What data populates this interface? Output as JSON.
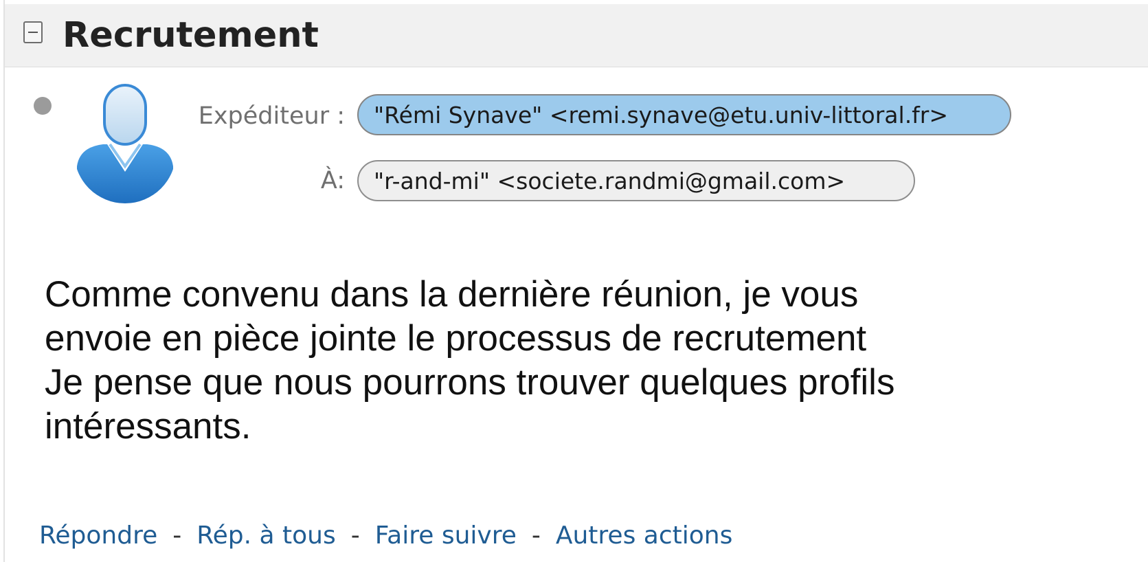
{
  "message": {
    "subject": "Recrutement",
    "from_label": "Expéditeur :",
    "from_value": "\"Rémi Synave\" <remi.synave@etu.univ-littoral.fr>",
    "to_label": "À:",
    "to_value": "\"r-and-mi\" <societe.randmi@gmail.com>",
    "body_lines": [
      "Comme convenu dans la dernière réunion, je vous",
      "envoie en pièce jointe le processus de recrutement",
      "Je pense que nous pourrons trouver quelques profils",
      "intéressants."
    ]
  },
  "actions": {
    "reply": "Répondre",
    "reply_all": "Rép. à tous",
    "forward": "Faire suivre",
    "more": "Autres actions",
    "separator": "-"
  },
  "icons": {
    "collapse": "collapse-minus-icon",
    "status": "unread-status-dot-icon",
    "avatar": "user-avatar-icon"
  },
  "colors": {
    "header_bg": "#f1f1f1",
    "from_pill_bg": "#9ccaec",
    "to_pill_bg": "#efefef",
    "link": "#1f5c93",
    "avatar_blue": "#2f86d3"
  }
}
